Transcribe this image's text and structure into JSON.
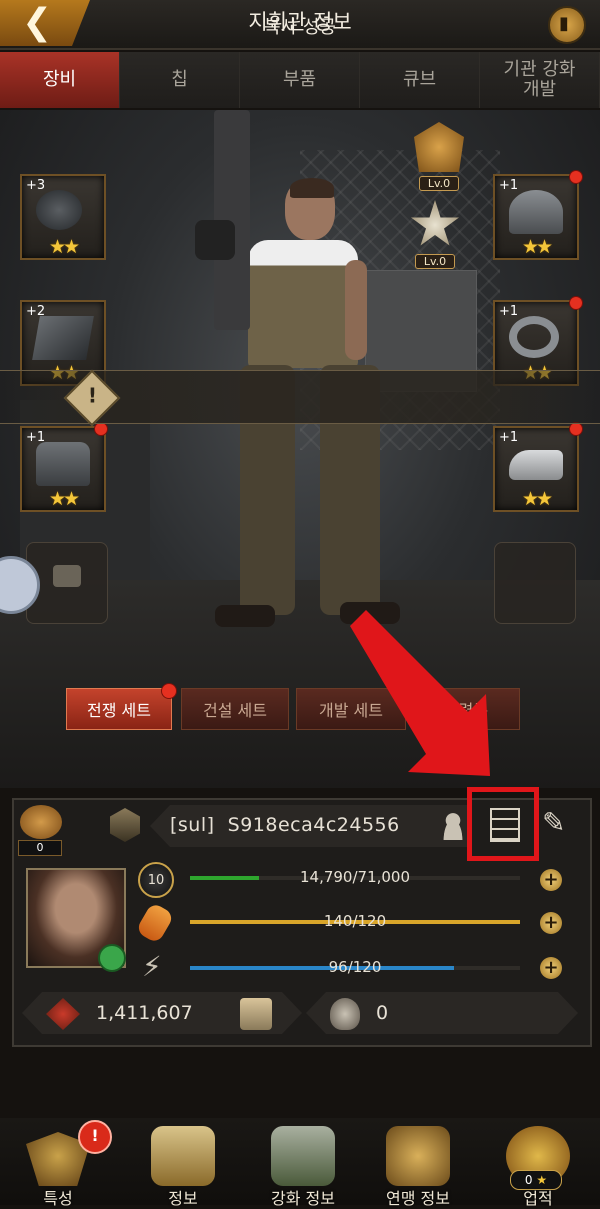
{
  "header": {
    "title": "지휘관 정보",
    "back_icon": "back-arrow-icon",
    "rank_icon": "ranking-icon"
  },
  "tabs": [
    {
      "label": "장비",
      "active": true
    },
    {
      "label": "칩",
      "active": false
    },
    {
      "label": "부품",
      "active": false
    },
    {
      "label": "큐브",
      "active": false
    },
    {
      "label": "기관 강화\n개발",
      "active": false
    }
  ],
  "equipment": {
    "slots": [
      {
        "name": "frying-pan",
        "level": "+3",
        "stars": "★★",
        "notify": false
      },
      {
        "name": "armor-plate",
        "level": "+2",
        "stars": "★★",
        "notify": false
      },
      {
        "name": "jacket",
        "level": "+1",
        "stars": "★★",
        "notify": true
      },
      {
        "name": "cap",
        "level": "+1",
        "stars": "★★",
        "notify": true
      },
      {
        "name": "ring",
        "level": "+1",
        "stars": "★★",
        "notify": true
      },
      {
        "name": "sneakers",
        "level": "+1",
        "stars": "★★",
        "notify": true
      }
    ],
    "badges": [
      {
        "label": "Lv.0"
      },
      {
        "label": "Lv.0"
      }
    ]
  },
  "toast": {
    "text": "복사 성공",
    "icon": "warning-icon"
  },
  "set_buttons": [
    {
      "label": "전쟁 세트",
      "active": true,
      "notify": true
    },
    {
      "label": "건설 세트",
      "active": false
    },
    {
      "label": "개발 세트",
      "active": false
    },
    {
      "label": "훈련복",
      "active": false
    }
  ],
  "profile": {
    "like_count": "0",
    "alliance_tag": "[sul]",
    "player_id": "S918eca4c24556",
    "level": "10",
    "bars": [
      {
        "label": "14,790/71,000",
        "fill": 0.208,
        "color": "#2ea62e"
      },
      {
        "label": "140/120",
        "fill": 1.0,
        "color": "#d9a52a"
      },
      {
        "label": "96/120",
        "fill": 0.8,
        "color": "#2a86c9"
      }
    ],
    "power": "1,411,607",
    "kills": "0"
  },
  "nav": [
    {
      "label": "특성",
      "notify": true
    },
    {
      "label": "정보"
    },
    {
      "label": "강화 정보"
    },
    {
      "label": "연맹 정보"
    },
    {
      "label": "업적",
      "count": "0"
    }
  ],
  "colors": {
    "accent_red": "#a93327",
    "annotation_red": "#e0161a",
    "star_gold": "#f4c63a"
  }
}
